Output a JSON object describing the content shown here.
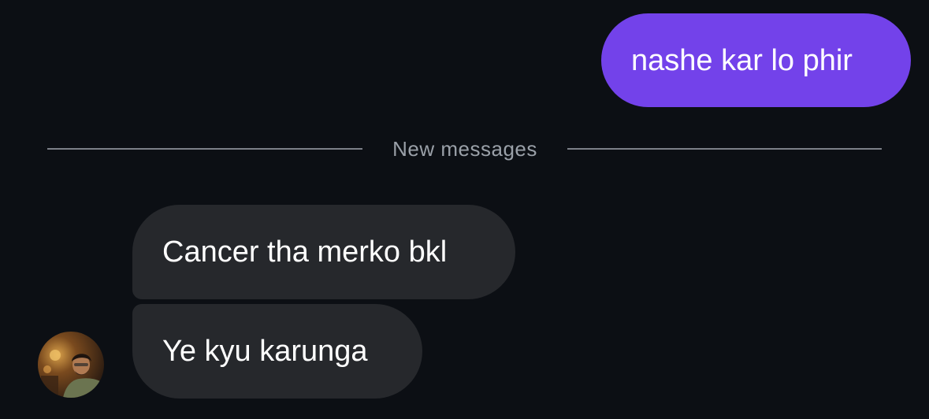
{
  "messages": {
    "outgoing": [
      {
        "text": "nashe kar lo phir"
      }
    ],
    "divider_label": "New messages",
    "incoming": [
      {
        "text": "Cancer tha merko bkl"
      },
      {
        "text": "Ye kyu karunga"
      }
    ]
  },
  "colors": {
    "background": "#0c0f14",
    "outgoing_bubble": "#7342ea",
    "incoming_bubble": "#26282c",
    "divider": "#7c8088"
  },
  "icons": {
    "avatar": "sender-avatar-photo"
  }
}
